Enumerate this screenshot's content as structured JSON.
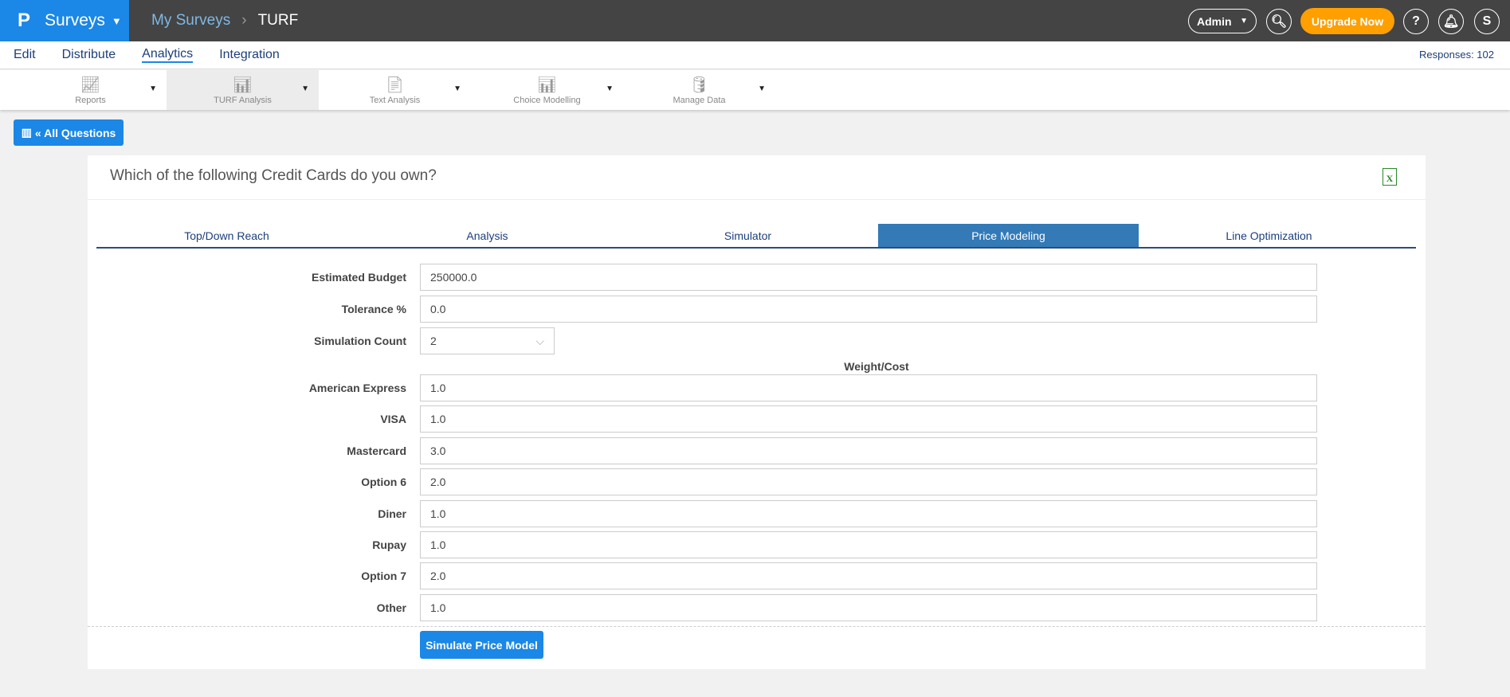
{
  "header": {
    "logo": "P",
    "app": "Surveys",
    "breadcrumb": [
      "My Surveys",
      "TURF"
    ],
    "admin": "Admin",
    "upgrade": "Upgrade Now",
    "help": "?",
    "user_initial": "S"
  },
  "nav": {
    "items": [
      "Edit",
      "Distribute",
      "Analytics",
      "Integration"
    ],
    "responses": "Responses: 102"
  },
  "toolbar": [
    "Reports",
    "TURF Analysis",
    "Text Analysis",
    "Choice Modelling",
    "Manage Data"
  ],
  "all_questions": "« All Questions",
  "question": "Which of the following Credit Cards do you own?",
  "tabs": [
    "Top/Down Reach",
    "Analysis",
    "Simulator",
    "Price Modeling",
    "Line Optimization"
  ],
  "form": {
    "budget_label": "Estimated Budget",
    "budget": "250000.0",
    "tolerance_label": "Tolerance %",
    "tolerance": "0.0",
    "sim_count_label": "Simulation Count",
    "sim_count": "2",
    "weight_header": "Weight/Cost",
    "options": [
      {
        "label": "American Express",
        "value": "1.0"
      },
      {
        "label": "VISA",
        "value": "1.0"
      },
      {
        "label": "Mastercard",
        "value": "3.0"
      },
      {
        "label": "Option 6",
        "value": "2.0"
      },
      {
        "label": "Diner",
        "value": "1.0"
      },
      {
        "label": "Rupay",
        "value": "1.0"
      },
      {
        "label": "Option 7",
        "value": "2.0"
      },
      {
        "label": "Other",
        "value": "1.0"
      }
    ],
    "submit": "Simulate Price Model"
  },
  "colors": {
    "primary": "#1b87e6",
    "upgrade": "#ff9f00",
    "active_tab": "#337ab7"
  }
}
